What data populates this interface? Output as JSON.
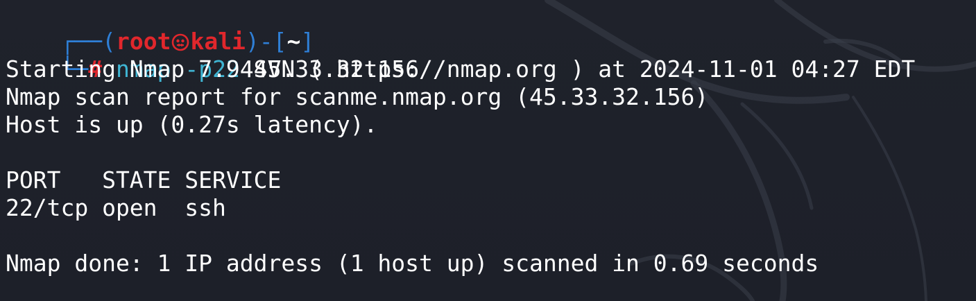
{
  "prompt": {
    "open_paren": "┌──(",
    "user": "root",
    "host": "kali",
    "close_paren": ")-[",
    "cwd": "~",
    "close_bracket": "]",
    "corner": "└─",
    "symbol": "#"
  },
  "command": {
    "program": "nmap",
    "flag": "-p22",
    "target": "45.33.32.156"
  },
  "output": {
    "line_1": "Starting Nmap 7.94SVN ( https://nmap.org ) at 2024-11-01 04:27 EDT",
    "line_2": "Nmap scan report for scanme.nmap.org (45.33.32.156)",
    "line_3": "Host is up (0.27s latency).",
    "table_header": "PORT   STATE SERVICE",
    "table_row_1": "22/tcp open  ssh",
    "summary": "Nmap done: 1 IP address (1 host up) scanned in 0.69 seconds"
  },
  "colors": {
    "background": "#1e212a",
    "prompt_tree": "#2f7fd6",
    "prompt_user_host": "#e1272c",
    "command_text": "#3fb5d3",
    "output_text": "#ffffff"
  },
  "icons": {
    "prompt_separator": "kali-skull-icon",
    "background_watermark": "kali-dragon-icon"
  }
}
